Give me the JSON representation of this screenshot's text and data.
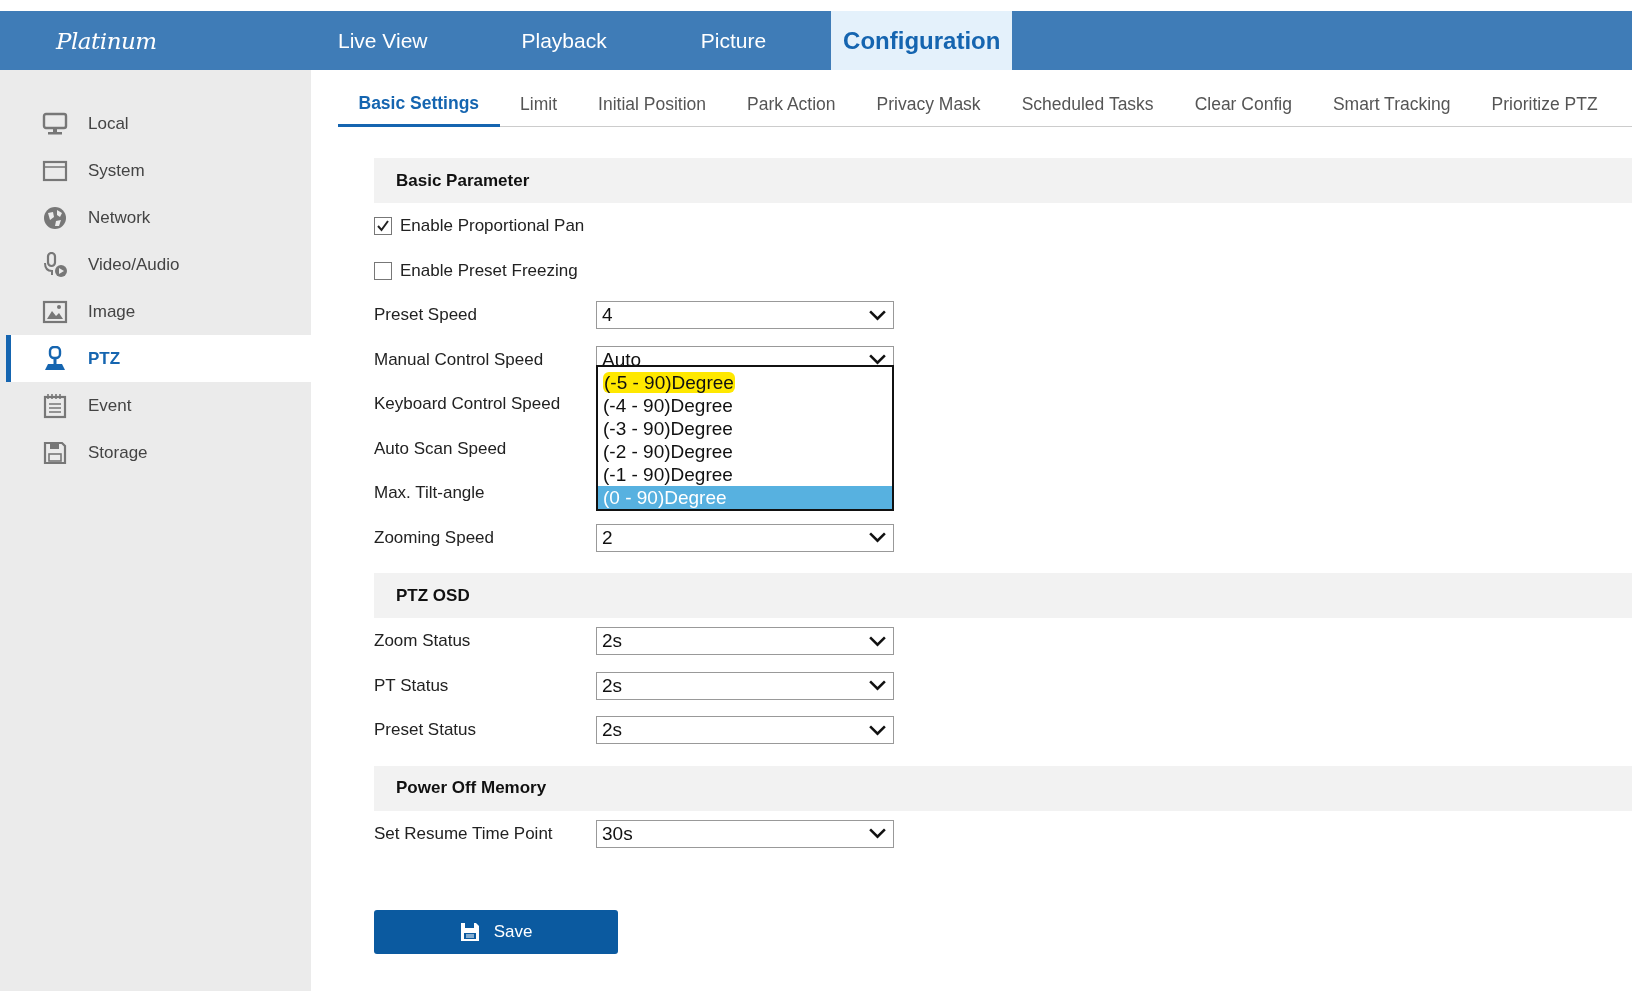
{
  "logo": "Platinum",
  "top_nav": [
    {
      "label": "Live View",
      "selected": false
    },
    {
      "label": "Playback",
      "selected": false
    },
    {
      "label": "Picture",
      "selected": false
    },
    {
      "label": "Configuration",
      "selected": true
    }
  ],
  "sidebar": {
    "items": [
      {
        "label": "Local",
        "kind": "monitor",
        "selected": false
      },
      {
        "label": "System",
        "kind": "window",
        "selected": false
      },
      {
        "label": "Network",
        "kind": "globe",
        "selected": false
      },
      {
        "label": "Video/Audio",
        "kind": "mic",
        "selected": false
      },
      {
        "label": "Image",
        "kind": "image",
        "selected": false
      },
      {
        "label": "PTZ",
        "kind": "ptz",
        "selected": true
      },
      {
        "label": "Event",
        "kind": "calendar",
        "selected": false
      },
      {
        "label": "Storage",
        "kind": "disk",
        "selected": false
      }
    ]
  },
  "tabs": [
    {
      "label": "Basic Settings",
      "selected": true
    },
    {
      "label": "Limit",
      "selected": false
    },
    {
      "label": "Initial Position",
      "selected": false
    },
    {
      "label": "Park Action",
      "selected": false
    },
    {
      "label": "Privacy Mask",
      "selected": false
    },
    {
      "label": "Scheduled Tasks",
      "selected": false
    },
    {
      "label": "Clear Config",
      "selected": false
    },
    {
      "label": "Smart Tracking",
      "selected": false
    },
    {
      "label": "Prioritize PTZ",
      "selected": false
    }
  ],
  "sections": [
    {
      "title": "Basic Parameter",
      "rows": [
        {
          "kind": "checkbox",
          "label": "Enable Proportional Pan",
          "checked": true
        },
        {
          "kind": "checkbox",
          "label": "Enable Preset Freezing",
          "checked": false
        },
        {
          "kind": "select",
          "label": "Preset Speed",
          "value": "4"
        },
        {
          "kind": "select",
          "label": "Manual Control Speed",
          "value": "Auto",
          "open": true,
          "options": [
            {
              "label": "(-5 - 90)Degree",
              "selected": false,
              "highlighted": true
            },
            {
              "label": "(-4 - 90)Degree",
              "selected": false,
              "highlighted": false
            },
            {
              "label": "(-3 - 90)Degree",
              "selected": false,
              "highlighted": false
            },
            {
              "label": "(-2 - 90)Degree",
              "selected": false,
              "highlighted": false
            },
            {
              "label": "(-1 - 90)Degree",
              "selected": false,
              "highlighted": false
            },
            {
              "label": "(0 - 90)Degree",
              "selected": true,
              "highlighted": false
            }
          ]
        },
        {
          "kind": "select",
          "label": "Keyboard Control Speed"
        },
        {
          "kind": "select",
          "label": "Auto Scan Speed"
        },
        {
          "kind": "select",
          "label": "Max. Tilt-angle"
        },
        {
          "kind": "select",
          "label": "Zooming Speed",
          "value": "2"
        }
      ]
    },
    {
      "title": "PTZ OSD",
      "rows": [
        {
          "kind": "select",
          "label": "Zoom Status",
          "value": "2s"
        },
        {
          "kind": "select",
          "label": "PT Status",
          "value": "2s"
        },
        {
          "kind": "select",
          "label": "Preset Status",
          "value": "2s"
        }
      ]
    },
    {
      "title": "Power Off Memory",
      "rows": [
        {
          "kind": "select",
          "label": "Set Resume Time Point",
          "value": "30s"
        }
      ]
    }
  ],
  "save_button": "Save"
}
